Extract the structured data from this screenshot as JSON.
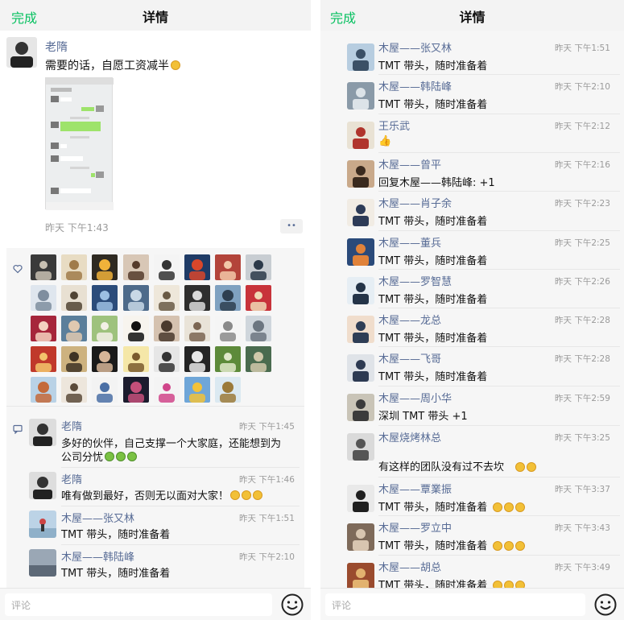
{
  "left": {
    "done": "完成",
    "title": "详情",
    "post": {
      "author": "老隋",
      "text": "需要的话，自愿工资减半",
      "time": "昨天 下午1:43",
      "more": "••"
    },
    "comments": [
      {
        "name": "老隋",
        "time": "昨天 下午1:45",
        "line1": "多好的伙伴，自己支撑一个大家庭，还能想到为",
        "line2": "公司分忧"
      },
      {
        "name": "老隋",
        "time": "昨天 下午1:46",
        "line1": "唯有做到最好，否则无以面对大家！"
      },
      {
        "name": "木屋——张又林",
        "time": "昨天 下午1:51",
        "line1": "TMT 带头，随时准备着"
      },
      {
        "name": "木屋——韩陆峰",
        "time": "昨天 下午2:10",
        "line1": "TMT 带头，随时准备着"
      }
    ],
    "comment_placeholder": "评论"
  },
  "right": {
    "done": "完成",
    "title": "详情",
    "comments": [
      {
        "name": "木屋——张又林",
        "time": "昨天 下午1:51",
        "line1": "TMT 带头，随时准备着"
      },
      {
        "name": "木屋——韩陆峰",
        "time": "昨天 下午2:10",
        "line1": "TMT 带头，随时准备着"
      },
      {
        "name": "王乐武",
        "time": "昨天 下午2:12",
        "line1": "👍"
      },
      {
        "name": "木屋——曾平",
        "time": "昨天 下午2:16",
        "line1": "回复木屋——韩陆峰: +1"
      },
      {
        "name": "木屋——肖子余",
        "time": "昨天 下午2:23",
        "line1": "TMT 带头，随时准备着"
      },
      {
        "name": "木屋——董兵",
        "time": "昨天 下午2:25",
        "line1": "TMT 带头，随时准备着"
      },
      {
        "name": "木屋——罗智慧",
        "time": "昨天 下午2:26",
        "line1": "TMT 带头，随时准备着"
      },
      {
        "name": "木屋——龙总",
        "time": "昨天 下午2:28",
        "line1": "TMT 带头，随时准备着"
      },
      {
        "name": "木屋——飞哥",
        "time": "昨天 下午2:28",
        "line1": "TMT 带头，随时准备着"
      },
      {
        "name": "木屋——周小华",
        "time": "昨天 下午2:59",
        "line1": "深圳 TMT 带头 +1"
      },
      {
        "name": "木屋烧烤林总",
        "time": "昨天 下午3:25",
        "line1": "有这样的团队没有过不去坎"
      },
      {
        "name": "木屋——覃業振",
        "time": "昨天 下午3:37",
        "line1": "TMT 带头，随时准备着"
      },
      {
        "name": "木屋——罗立中",
        "time": "昨天 下午3:43",
        "line1": "TMT 带头，随时准备着"
      },
      {
        "name": "木屋——胡总",
        "time": "昨天 下午3:49",
        "line1": "TMT 带头，随时准备着"
      }
    ],
    "comment_placeholder": "评论"
  },
  "colors": {
    "accent_green": "#07c160",
    "name_blue": "#576b95",
    "time_gray": "#9a9a9a"
  }
}
